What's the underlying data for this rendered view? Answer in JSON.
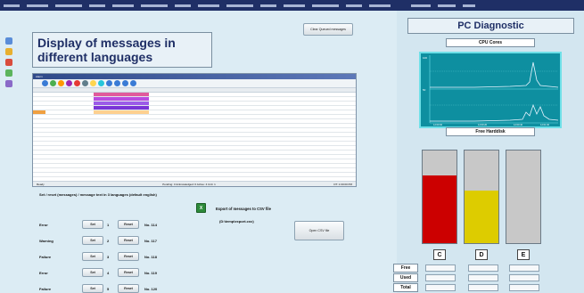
{
  "headline": "Display of messages in different languages",
  "buttons": {
    "top": "Clear Queued messages",
    "open_csv": "Open CSV file",
    "set": "Set",
    "reset": "Reset"
  },
  "set_label": "Set / reset (messages) / message text in 3 languages (default english)",
  "messages": [
    {
      "type": "Error",
      "num": "1",
      "no": "No. 114"
    },
    {
      "type": "Warning",
      "num": "2",
      "no": "No. 117"
    },
    {
      "type": "Failure",
      "num": "3",
      "no": "No. 118"
    },
    {
      "type": "Error",
      "num": "4",
      "no": "No. 119"
    },
    {
      "type": "Failure",
      "num": "5",
      "no": "No. 120"
    }
  ],
  "export_label": "Export of messages to CSV file",
  "path_label": "(D:\\temp\\export.csv)",
  "window": {
    "status_left": "Ready",
    "status_mid": "Pending: 3   Acknowledged: 0   Active: 4   Unit: 1",
    "status_right": "DT: 1:00:00 PM"
  },
  "pc_title": "PC Diagnostic",
  "cpu_title": "CPU Cores",
  "disk_title": "Free Harddisk",
  "drives": [
    {
      "letter": "C",
      "fill_pct": 73,
      "color": "#cc0000"
    },
    {
      "letter": "D",
      "fill_pct": 57,
      "color": "#ddcc00"
    },
    {
      "letter": "E",
      "fill_pct": 0,
      "color": "#c8c8c8"
    }
  ],
  "stats": [
    "Free",
    "Used",
    "Total"
  ],
  "colors": {
    "accent": "#1f2f66",
    "chart_bg": "#0e8fa0",
    "chart_line": "#6fe0e8"
  }
}
